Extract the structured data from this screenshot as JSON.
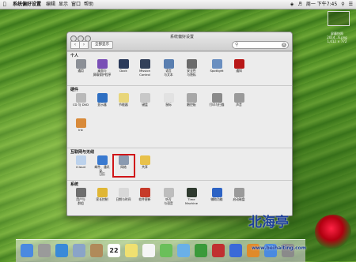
{
  "menubar": {
    "app": "系统偏好设置",
    "menus": [
      "编辑",
      "显示",
      "窗口",
      "帮助"
    ],
    "clock": "周一 下午7:45"
  },
  "desktop_thumb": {
    "line1": "屏幕快照",
    "line2": "2014...6.png",
    "line3": "1,012 × 772"
  },
  "window": {
    "title": "系统偏好设置",
    "show_all": "全部显示",
    "search_placeholder": ""
  },
  "sections": [
    {
      "title": "个人",
      "items": [
        {
          "label": "通用",
          "icon": "general-icon",
          "color": "#8b8f96"
        },
        {
          "label": "桌面与\n屏幕保护程序",
          "icon": "desktop-icon",
          "color": "#7a4fb6"
        },
        {
          "label": "Dock",
          "icon": "dock-icon",
          "color": "#2a3a5a"
        },
        {
          "label": "Mission\nControl",
          "icon": "mission-control-icon",
          "color": "#32405a"
        },
        {
          "label": "语言\n与文本",
          "icon": "language-icon",
          "color": "#5a7fb0"
        },
        {
          "label": "安全性\n与隐私",
          "icon": "security-icon",
          "color": "#6b6b6b"
        },
        {
          "label": "Spotlight",
          "icon": "spotlight-icon",
          "color": "#6a8fc0"
        },
        {
          "label": "通知",
          "icon": "notifications-icon",
          "color": "#b81818"
        }
      ]
    },
    {
      "title": "硬件",
      "items": [
        {
          "label": "CD 与 DVD",
          "icon": "cd-icon",
          "color": "#b9b9b9"
        },
        {
          "label": "显示器",
          "icon": "display-icon",
          "color": "#2e6fc2"
        },
        {
          "label": "节能器",
          "icon": "energy-saver-icon",
          "color": "#e8d67a"
        },
        {
          "label": "键盘",
          "icon": "keyboard-icon",
          "color": "#c8c8c8"
        },
        {
          "label": "鼠标",
          "icon": "mouse-icon",
          "color": "#e2e2e2"
        },
        {
          "label": "触控板",
          "icon": "trackpad-icon",
          "color": "#a7a7a7"
        },
        {
          "label": "打印与扫描",
          "icon": "printer-icon",
          "color": "#8a8a8a"
        },
        {
          "label": "声音",
          "icon": "sound-icon",
          "color": "#9a9a9a"
        },
        {
          "label": "Ink",
          "icon": "ink-icon",
          "color": "#d88a3a"
        }
      ]
    },
    {
      "title": "互联网与无线",
      "items": [
        {
          "label": "iCloud",
          "icon": "icloud-icon",
          "color": "#bcd2ec"
        },
        {
          "label": "邮件、通讯录、\n日历",
          "icon": "mail-contacts-icon",
          "color": "#3a7ad0"
        },
        {
          "label": "网络",
          "icon": "network-icon",
          "color": "#8a9ab0"
        },
        {
          "label": "共享",
          "icon": "sharing-icon",
          "color": "#e8c14a"
        }
      ]
    },
    {
      "title": "系统",
      "items": [
        {
          "label": "用户与\n群组",
          "icon": "users-icon",
          "color": "#6e6e6e"
        },
        {
          "label": "家长控制",
          "icon": "parental-icon",
          "color": "#e0b634"
        },
        {
          "label": "日期与时间",
          "icon": "datetime-icon",
          "color": "#d8d8d8"
        },
        {
          "label": "软件更新",
          "icon": "software-update-icon",
          "color": "#c63a2a"
        },
        {
          "label": "听写\n与语音",
          "icon": "dictation-icon",
          "color": "#bdbdbd"
        },
        {
          "label": "Time Machine",
          "icon": "time-machine-icon",
          "color": "#2f3a2f"
        },
        {
          "label": "辅助功能",
          "icon": "accessibility-icon",
          "color": "#2d63c4"
        },
        {
          "label": "启动磁盘",
          "icon": "startup-disk-icon",
          "color": "#9a9a9a"
        }
      ]
    }
  ],
  "highlighted_item": "网络",
  "dock": {
    "calendar_day": "22",
    "items": [
      {
        "icon": "finder-icon",
        "color": "#4a8ae0"
      },
      {
        "icon": "launchpad-icon",
        "color": "#9a9a9a"
      },
      {
        "icon": "safari-icon",
        "color": "#3a8ad8"
      },
      {
        "icon": "mail-icon",
        "color": "#8aa4c8"
      },
      {
        "icon": "contacts-icon",
        "color": "#b08a5a"
      },
      {
        "icon": "calendar-icon",
        "color": "#ffffff"
      },
      {
        "icon": "notes-icon",
        "color": "#f0e070"
      },
      {
        "icon": "reminders-icon",
        "color": "#f5f5f5"
      },
      {
        "icon": "maps-icon",
        "color": "#6abf5a"
      },
      {
        "icon": "messages-icon",
        "color": "#6ab0e8"
      },
      {
        "icon": "facetime-icon",
        "color": "#3a9a3a"
      },
      {
        "icon": "photo-booth-icon",
        "color": "#c03030"
      },
      {
        "icon": "itunes-icon",
        "color": "#3a6ad8"
      },
      {
        "icon": "ibooks-icon",
        "color": "#e08a2a"
      },
      {
        "icon": "app-store-icon",
        "color": "#4a8ae0"
      },
      {
        "icon": "system-preferences-icon",
        "color": "#8a8a8a"
      }
    ]
  },
  "watermark": {
    "text": "北海亭",
    "url": "www.beihaiting.com"
  }
}
